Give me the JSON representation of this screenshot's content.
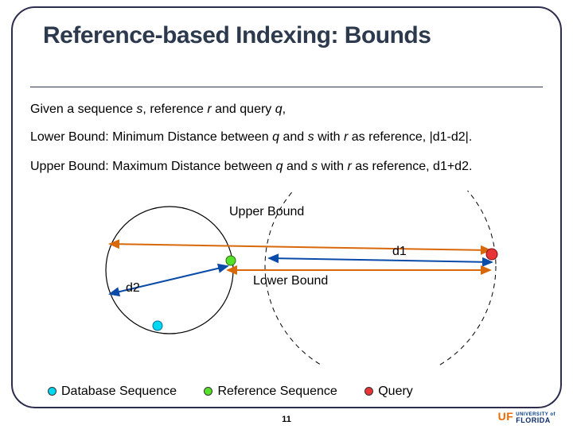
{
  "title": "Reference-based Indexing: Bounds",
  "given": "Given a sequence ",
  "var_s": "s",
  "given2": ", reference ",
  "var_r": "r",
  "given3": " and query ",
  "var_q": "q",
  "given4": ",",
  "lower": "Lower Bound: Minimum Distance between ",
  "lower2": " and ",
  "lower3": " with ",
  "lower4": " as reference, |d1-d2|.",
  "upper": "Upper Bound: Maximum Distance between ",
  "upper2": " and ",
  "upper3": " with ",
  "upper4": " as reference, d1+d2.",
  "labels": {
    "upper_bound": "Upper Bound",
    "lower_bound": "Lower Bound",
    "d1": "d1",
    "d2": "d2"
  },
  "legend": {
    "db": "Database Sequence",
    "ref": "Reference Sequence",
    "query": "Query"
  },
  "page": "11",
  "logo": {
    "uf": "UF",
    "florida": "FLORIDA",
    "univ": "UNIVERSITY of"
  }
}
